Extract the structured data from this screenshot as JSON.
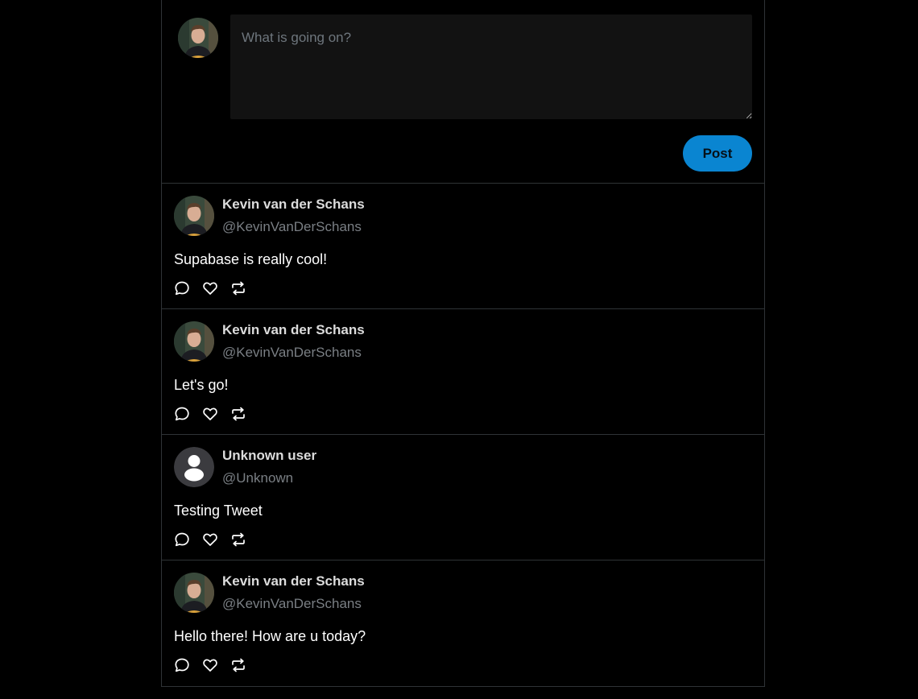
{
  "composer": {
    "placeholder": "What is going on?",
    "post_label": "Post",
    "avatar": "user-avatar-photo"
  },
  "colors": {
    "background": "#000000",
    "accent": "#0a85d1",
    "divider": "#2f3336",
    "input_background": "#121212",
    "handle_text": "#7a7f84"
  },
  "tweets": [
    {
      "author": "Kevin van der Schans",
      "handle": "@KevinVanDerSchans",
      "content": "Supabase is really cool!",
      "avatar": "photo"
    },
    {
      "author": "Kevin van der Schans",
      "handle": "@KevinVanDerSchans",
      "content": "Let's go!",
      "avatar": "photo"
    },
    {
      "author": "Unknown user",
      "handle": "@Unknown",
      "content": "Testing Tweet",
      "avatar": "default-person-icon"
    },
    {
      "author": "Kevin van der Schans",
      "handle": "@KevinVanDerSchans",
      "content": "Hello there! How are u today?",
      "avatar": "photo"
    }
  ],
  "action_icons": [
    "comment-icon",
    "heart-icon",
    "retweet-icon"
  ]
}
